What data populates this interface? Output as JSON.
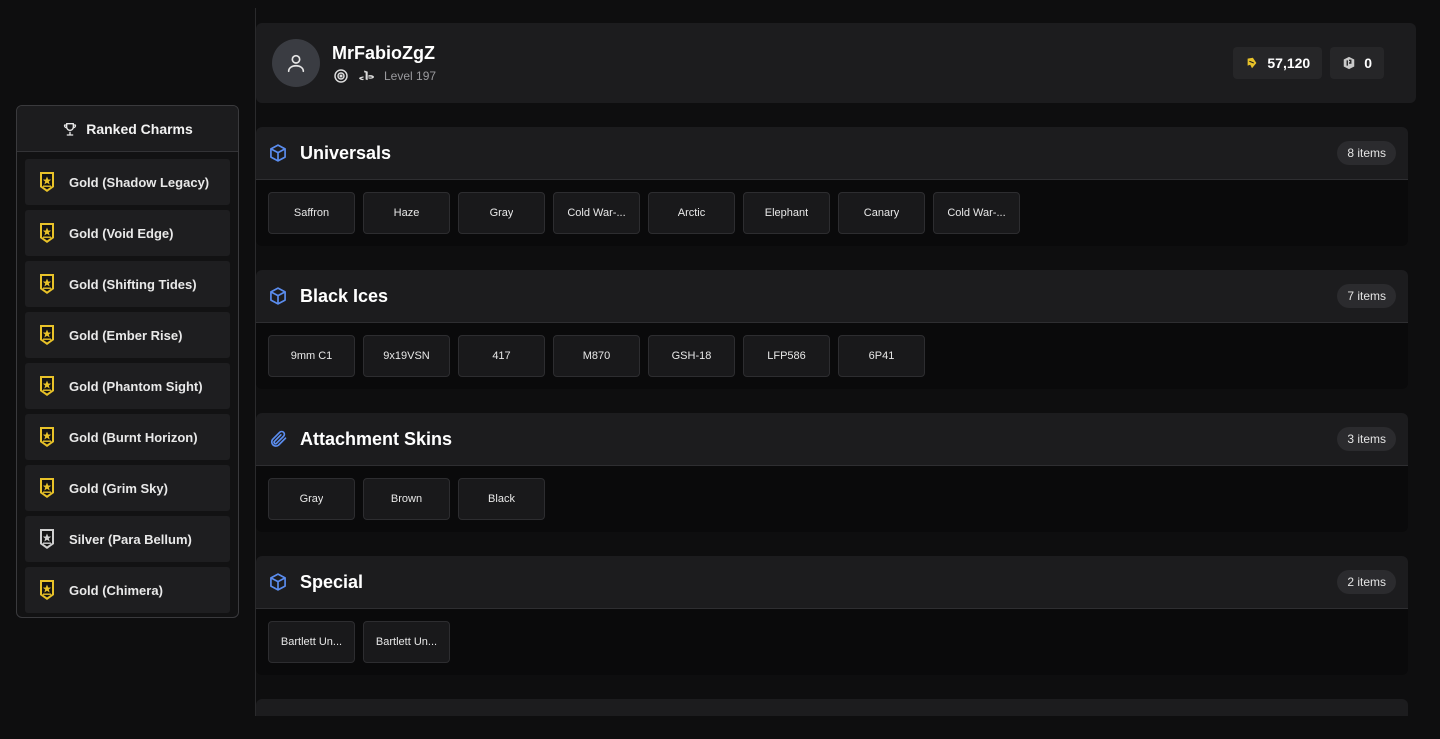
{
  "sidebar": {
    "title": "Ranked Charms",
    "items": [
      {
        "label": "Gold (Shadow Legacy)",
        "tier": "gold"
      },
      {
        "label": "Gold (Void Edge)",
        "tier": "gold"
      },
      {
        "label": "Gold (Shifting Tides)",
        "tier": "gold"
      },
      {
        "label": "Gold (Ember Rise)",
        "tier": "gold"
      },
      {
        "label": "Gold (Phantom Sight)",
        "tier": "gold"
      },
      {
        "label": "Gold (Burnt Horizon)",
        "tier": "gold"
      },
      {
        "label": "Gold (Grim Sky)",
        "tier": "gold"
      },
      {
        "label": "Silver (Para Bellum)",
        "tier": "silver"
      },
      {
        "label": "Gold (Chimera)",
        "tier": "gold"
      }
    ]
  },
  "profile": {
    "username": "MrFabioZgZ",
    "level": "Level 197",
    "platforms": [
      "ubisoft-icon",
      "playstation-icon"
    ],
    "currencies": [
      {
        "icon": "renown-icon",
        "value": "57,120"
      },
      {
        "icon": "r6-credits-icon",
        "value": "0"
      }
    ]
  },
  "sections": [
    {
      "title": "Universals",
      "count": "8 items",
      "icon": "cube-icon",
      "items": [
        "Saffron",
        "Haze",
        "Gray",
        "Cold War-...",
        "Arctic",
        "Elephant",
        "Canary",
        "Cold War-..."
      ]
    },
    {
      "title": "Black Ices",
      "count": "7 items",
      "icon": "cube-icon",
      "items": [
        "9mm C1",
        "9x19VSN",
        "417",
        "M870",
        "GSH-18",
        "LFP586",
        "6P41"
      ]
    },
    {
      "title": "Attachment Skins",
      "count": "3 items",
      "icon": "paperclip-icon",
      "items": [
        "Gray",
        "Brown",
        "Black"
      ]
    },
    {
      "title": "Special",
      "count": "2 items",
      "icon": "cube-icon",
      "items": [
        "Bartlett Un...",
        "Bartlett Un..."
      ]
    }
  ],
  "colors": {
    "accent_blue": "#5b8def",
    "gold": "#e8c229",
    "silver": "#c9c9c9",
    "background": "#0e0e0f",
    "panel": "#1c1c1e"
  }
}
